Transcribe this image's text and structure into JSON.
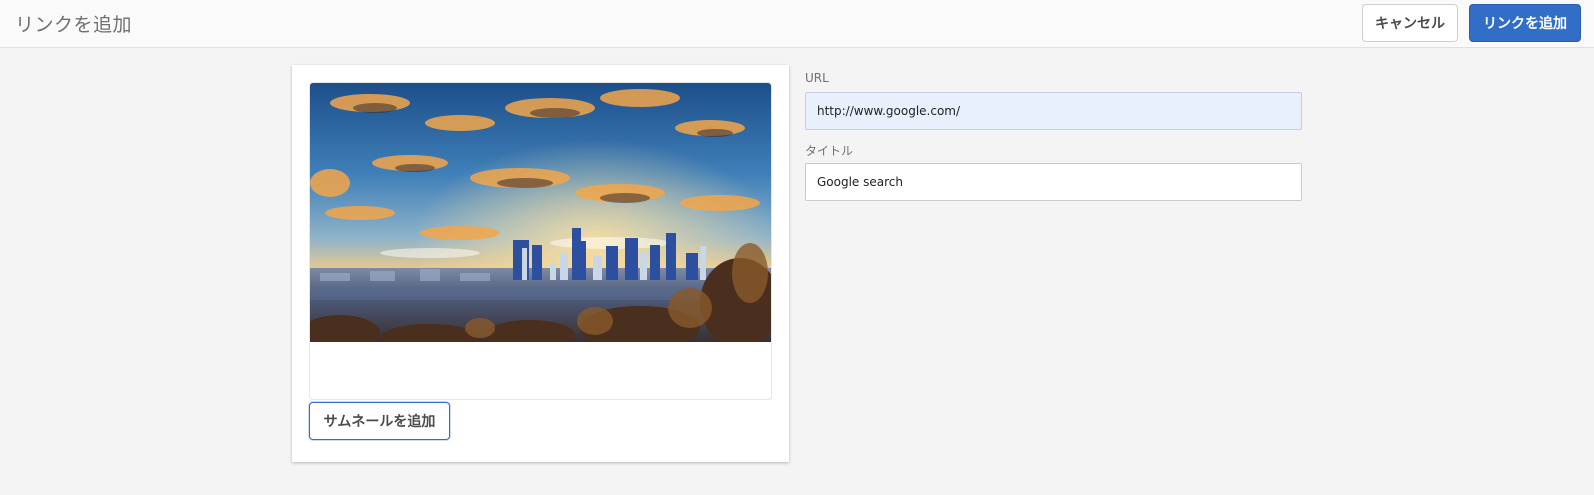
{
  "header": {
    "title": "リンクを追加",
    "cancel_label": "キャンセル",
    "add_label": "リンクを追加"
  },
  "thumbnail": {
    "add_label": "サムネールを追加"
  },
  "form": {
    "url_label": "URL",
    "url_value": "http://www.google.com/",
    "title_label": "タイトル",
    "title_value": "Google search"
  },
  "colors": {
    "accent": "#326ec8",
    "url_autofill_bg": "#e8f0fe",
    "page_bg": "#f4f4f4"
  }
}
